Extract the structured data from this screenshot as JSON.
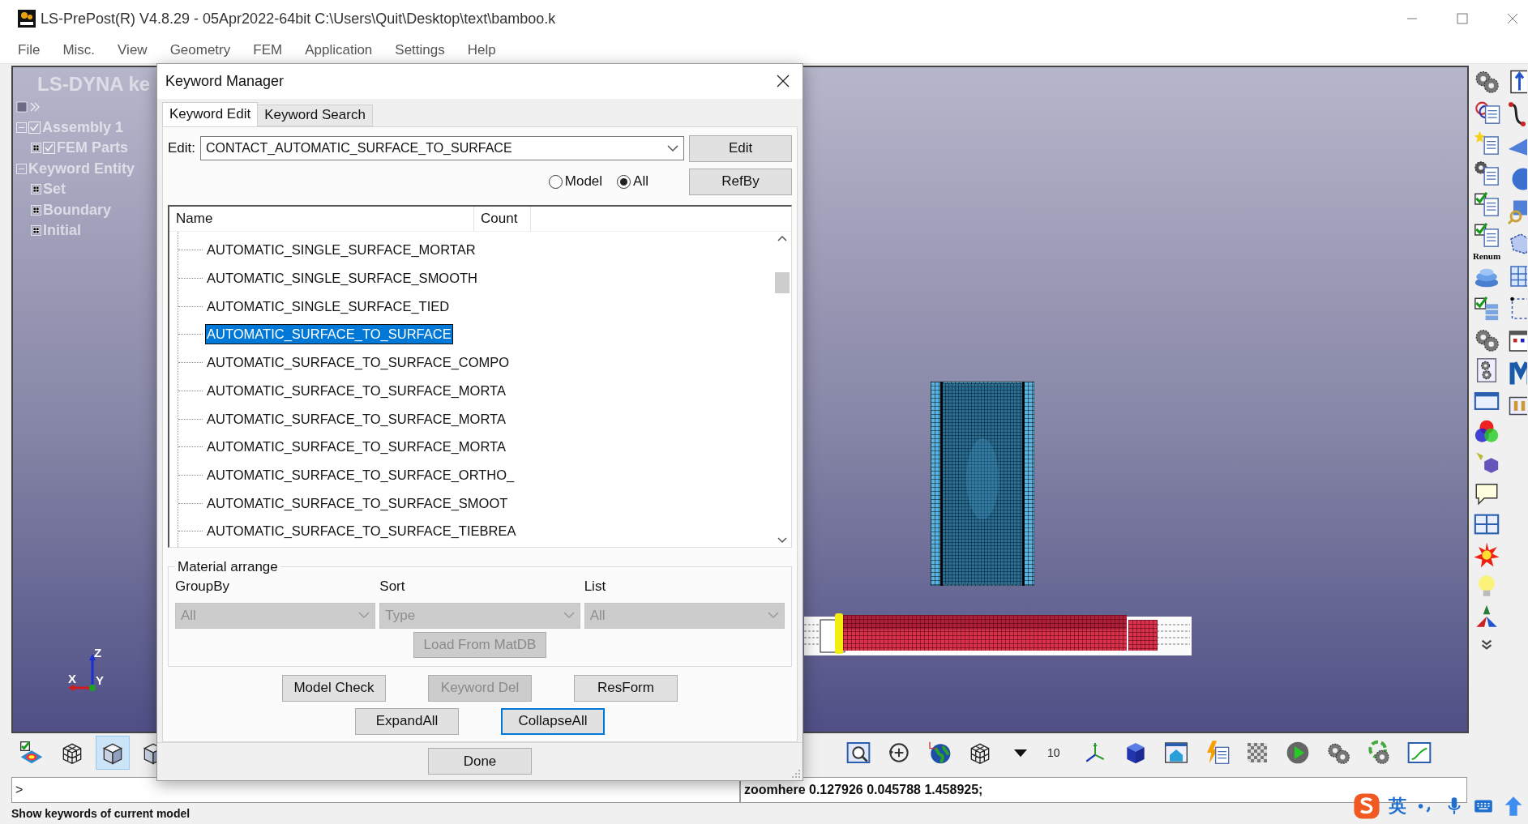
{
  "window": {
    "title": "LS-PrePost(R) V4.8.29 - 05Apr2022-64bit C:\\Users\\Quit\\Desktop\\text\\bamboo.k"
  },
  "menu": [
    "File",
    "Misc.",
    "View",
    "Geometry",
    "FEM",
    "Application",
    "Settings",
    "Help"
  ],
  "model_tree": {
    "title": "LS-DYNA ke",
    "items": [
      {
        "label": "Assembly 1",
        "checked": true,
        "expanded": true,
        "children": [
          {
            "label": "FEM Parts",
            "checked": true,
            "expanded": false
          }
        ]
      },
      {
        "label": "Keyword Entity",
        "expanded": true,
        "children": [
          {
            "label": "Set",
            "expanded": false
          },
          {
            "label": "Boundary",
            "expanded": false
          },
          {
            "label": "Initial",
            "expanded": false
          }
        ]
      }
    ]
  },
  "viewport": {
    "axes": [
      "Z",
      "X",
      "Y"
    ]
  },
  "dialog": {
    "title": "Keyword Manager",
    "tabs": [
      {
        "label": "Keyword Edit",
        "selected": true
      },
      {
        "label": "Keyword Search",
        "selected": false
      }
    ],
    "edit": {
      "label": "Edit:",
      "value": "CONTACT_AUTOMATIC_SURFACE_TO_SURFACE"
    },
    "edit_button": "Edit",
    "scope": [
      {
        "label": "Model",
        "selected": false
      },
      {
        "label": "All",
        "selected": true
      }
    ],
    "refby_button": "RefBy",
    "list": {
      "columns": [
        "Name",
        "Count"
      ],
      "rows": [
        {
          "name": "AUTOMATIC_SINGLE_SURFACE_MORTAR",
          "selected": false
        },
        {
          "name": "AUTOMATIC_SINGLE_SURFACE_SMOOTH",
          "selected": false
        },
        {
          "name": "AUTOMATIC_SINGLE_SURFACE_TIED",
          "selected": false
        },
        {
          "name": "AUTOMATIC_SURFACE_TO_SURFACE",
          "selected": true
        },
        {
          "name": "AUTOMATIC_SURFACE_TO_SURFACE_COMPO",
          "selected": false
        },
        {
          "name": "AUTOMATIC_SURFACE_TO_SURFACE_MORTA",
          "selected": false
        },
        {
          "name": "AUTOMATIC_SURFACE_TO_SURFACE_MORTA",
          "selected": false
        },
        {
          "name": "AUTOMATIC_SURFACE_TO_SURFACE_MORTA",
          "selected": false
        },
        {
          "name": "AUTOMATIC_SURFACE_TO_SURFACE_ORTHO_",
          "selected": false
        },
        {
          "name": "AUTOMATIC_SURFACE_TO_SURFACE_SMOOT",
          "selected": false
        },
        {
          "name": "AUTOMATIC_SURFACE_TO_SURFACE_TIEBREA",
          "selected": false
        }
      ]
    },
    "material_arrange": {
      "title": "Material arrange",
      "selects": [
        {
          "label": "GroupBy",
          "value": "All",
          "disabled": true
        },
        {
          "label": "Sort",
          "value": "Type",
          "disabled": true
        },
        {
          "label": "List",
          "value": "All",
          "disabled": true
        }
      ],
      "load_button": {
        "label": "Load From MatDB",
        "disabled": true
      }
    },
    "action_rows": [
      {
        "buttons": [
          {
            "label": "Model Check",
            "disabled": false,
            "focused": false
          },
          {
            "label": "Keyword Del",
            "disabled": true,
            "focused": false
          },
          {
            "label": "ResForm",
            "disabled": false,
            "focused": false
          }
        ]
      },
      {
        "buttons": [
          {
            "label": "ExpandAll",
            "disabled": false,
            "focused": false
          },
          {
            "label": "CollapseAll",
            "disabled": false,
            "focused": true
          }
        ]
      }
    ],
    "done_button": "Done"
  },
  "bottom_toolbar": {
    "zoom_level": "10"
  },
  "right_toolbar": {
    "renum_label": "Renum"
  },
  "command_line": {
    "prompt": ">",
    "output": "zoomhere 0.127926 0.045788 1.458925;"
  },
  "status_bar": "Show keywords of current model",
  "ime": {
    "language": "英"
  }
}
